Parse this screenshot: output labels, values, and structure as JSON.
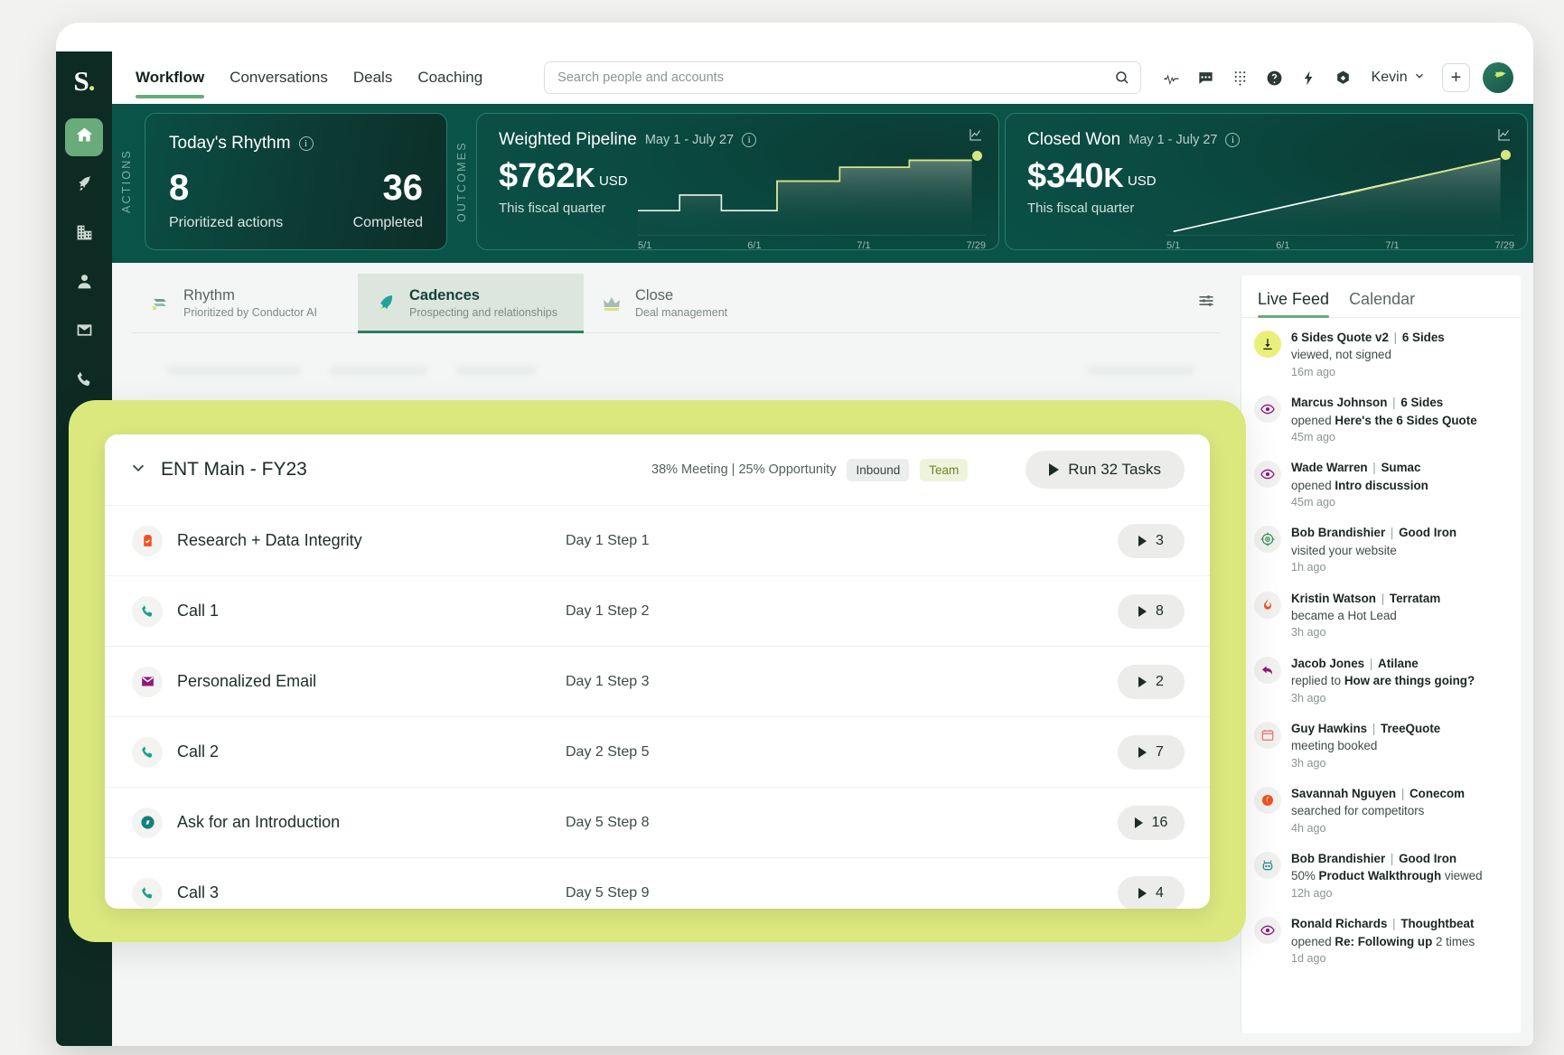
{
  "brand": {
    "letter": "S",
    "dot": "."
  },
  "sidebar": {
    "items": [
      {
        "name": "home-icon",
        "label": "Home",
        "active": true
      },
      {
        "name": "rocket-icon",
        "label": "Prospecting",
        "active": false
      },
      {
        "name": "building-icon",
        "label": "Accounts",
        "active": false
      },
      {
        "name": "person-icon",
        "label": "People",
        "active": false
      },
      {
        "name": "mail-icon",
        "label": "Email",
        "active": false
      },
      {
        "name": "phone-icon",
        "label": "Calls",
        "active": false
      }
    ]
  },
  "topnav": {
    "links": [
      {
        "label": "Workflow",
        "active": true
      },
      {
        "label": "Conversations",
        "active": false
      },
      {
        "label": "Deals",
        "active": false
      },
      {
        "label": "Coaching",
        "active": false
      }
    ],
    "search": {
      "placeholder": "Search people and accounts",
      "value": ""
    },
    "icons": [
      "activity-icon",
      "chat-icon",
      "dialpad-icon",
      "help-icon",
      "lightning-icon",
      "compass-icon"
    ],
    "user": "Kevin",
    "plus_label": "+"
  },
  "metrics": {
    "actions_label": "ACTIONS",
    "outcomes_label": "OUTCOMES",
    "rhythm": {
      "title": "Today's Rhythm",
      "left_value": "8",
      "left_label": "Prioritized actions",
      "right_value": "36",
      "right_label": "Completed"
    },
    "pipeline": {
      "title": "Weighted Pipeline",
      "range": "May 1 - July 27",
      "value": "$762",
      "unit": "K",
      "currency": "USD",
      "sub": "This fiscal quarter"
    },
    "closed": {
      "title": "Closed Won",
      "range": "May 1 - July 27",
      "value": "$340",
      "unit": "K",
      "currency": "USD",
      "sub": "This fiscal quarter"
    }
  },
  "chart_data": [
    {
      "type": "area",
      "title": "Weighted Pipeline",
      "xlabel": "",
      "ylabel": "USD",
      "tick_labels": [
        "5/1",
        "6/1",
        "7/1",
        "7/29"
      ],
      "x": [
        0,
        12,
        24,
        30,
        42,
        52,
        58,
        70,
        80,
        92,
        100
      ],
      "values": [
        30,
        30,
        44,
        44,
        30,
        30,
        62,
        62,
        80,
        92,
        92
      ],
      "ylim": [
        0,
        100
      ],
      "grid": false,
      "legend": "none",
      "accent_color": "#d8e57f",
      "line_color": "#eef2e6",
      "end_point_color": "#d8e57f"
    },
    {
      "type": "line",
      "title": "Closed Won",
      "xlabel": "",
      "ylabel": "USD",
      "tick_labels": [
        "5/1",
        "6/1",
        "7/1",
        "7/29"
      ],
      "x": [
        0,
        100
      ],
      "values": [
        4,
        88
      ],
      "ylim": [
        0,
        100
      ],
      "grid": false,
      "legend": "none",
      "accent_color": "#d8e57f",
      "line_color": "#ffffff",
      "end_point_color": "#d8e57f"
    }
  ],
  "tabs": [
    {
      "label": "Rhythm",
      "sub": "Prioritized by Conductor AI",
      "icon": "layers-icon",
      "active": false
    },
    {
      "label": "Cadences",
      "sub": "Prospecting and relationships",
      "icon": "rocket-icon",
      "active": true
    },
    {
      "label": "Close",
      "sub": "Deal management",
      "icon": "crown-icon",
      "active": false
    }
  ],
  "modal": {
    "title": "ENT Main - FY23",
    "stats": "38% Meeting | 25% Opportunity",
    "pill_inbound": "Inbound",
    "pill_team": "Team",
    "run_button": "Run 32 Tasks",
    "rows": [
      {
        "icon": "clipboard-check-icon",
        "icon_color": "#f0501e",
        "name": "Research + Data Integrity",
        "step": "Day 1 Step 1",
        "count": "3"
      },
      {
        "icon": "phone-icon",
        "icon_color": "#15a08c",
        "name": "Call 1",
        "step": "Day 1 Step 2",
        "count": "8"
      },
      {
        "icon": "mail-icon",
        "icon_color": "#8e1b7e",
        "name": "Personalized Email",
        "step": "Day 1 Step 3",
        "count": "2"
      },
      {
        "icon": "phone-icon",
        "icon_color": "#15a08c",
        "name": "Call 2",
        "step": "Day 2 Step 5",
        "count": "7"
      },
      {
        "icon": "compass-icon",
        "icon_color": "#11807c",
        "name": "Ask for an Introduction",
        "step": "Day 5 Step 8",
        "count": "16"
      },
      {
        "icon": "phone-icon",
        "icon_color": "#15a08c",
        "name": "Call 3",
        "step": "Day 5 Step 9",
        "count": "4"
      }
    ]
  },
  "feed": {
    "tabs": [
      {
        "label": "Live Feed",
        "active": true
      },
      {
        "label": "Calendar",
        "active": false
      }
    ],
    "items": [
      {
        "icon": "download-icon",
        "icon_color": "#1b2622",
        "icon_bg": "#e9f07a",
        "who": "6 Sides Quote v2",
        "org": "6 Sides",
        "action_pre": "viewed, not signed",
        "action_bold": "",
        "action_post": "",
        "time": "16m ago"
      },
      {
        "icon": "eye-icon",
        "icon_color": "#8e1b7e",
        "icon_bg": "#f1f1f0",
        "who": "Marcus Johnson",
        "org": "6 Sides",
        "action_pre": "opened ",
        "action_bold": "Here's the 6 Sides Quote",
        "action_post": "",
        "time": "45m ago"
      },
      {
        "icon": "eye-icon",
        "icon_color": "#8e1b7e",
        "icon_bg": "#f1f1f0",
        "who": "Wade Warren",
        "org": "Sumac",
        "action_pre": "opened ",
        "action_bold": "Intro discussion",
        "action_post": "",
        "time": "45m ago"
      },
      {
        "icon": "target-icon",
        "icon_color": "#2f8f55",
        "icon_bg": "#f1f1f0",
        "who": "Bob Brandishier",
        "org": "Good Iron",
        "action_pre": "visited your website",
        "action_bold": "",
        "action_post": "",
        "time": "1h ago"
      },
      {
        "icon": "flame-icon",
        "icon_color": "#f0501e",
        "icon_bg": "#f1f1f0",
        "who": "Kristin Watson",
        "org": "Terratam",
        "action_pre": "became a Hot Lead",
        "action_bold": "",
        "action_post": "",
        "time": "3h ago"
      },
      {
        "icon": "reply-icon",
        "icon_color": "#8e1b7e",
        "icon_bg": "#f1f1f0",
        "who": "Jacob Jones",
        "org": "Atilane",
        "action_pre": "replied to ",
        "action_bold": "How are things going?",
        "action_post": "",
        "time": "3h ago"
      },
      {
        "icon": "calendar-icon",
        "icon_color": "#f07a7a",
        "icon_bg": "#f1f1f0",
        "who": "Guy Hawkins",
        "org": "TreeQuote",
        "action_pre": "meeting booked",
        "action_bold": "",
        "action_post": "",
        "time": "3h ago"
      },
      {
        "icon": "search-moon-icon",
        "icon_color": "#f0501e",
        "icon_bg": "#f1f1f0",
        "who": "Savannah Nguyen",
        "org": "Conecom",
        "action_pre": "searched for competitors",
        "action_bold": "",
        "action_post": "",
        "time": "4h ago"
      },
      {
        "icon": "robot-icon",
        "icon_color": "#2f8f8a",
        "icon_bg": "#f1f1f0",
        "who": "Bob Brandishier",
        "org": "Good Iron",
        "action_pre": "50% ",
        "action_bold": "Product Walkthrough",
        "action_post": " viewed",
        "time": "12h ago"
      },
      {
        "icon": "eye-icon",
        "icon_color": "#8e1b7e",
        "icon_bg": "#f1f1f0",
        "who": "Ronald Richards",
        "org": "Thoughtbeat",
        "action_pre": "opened ",
        "action_bold": "Re: Following up",
        "action_post": " 2 times",
        "time": "1d ago"
      }
    ]
  },
  "colors": {
    "brand_dark": "#0d2b22",
    "band": "#0a5349",
    "accent_green": "#6aab7c",
    "accent_lime": "#dbe87e"
  }
}
